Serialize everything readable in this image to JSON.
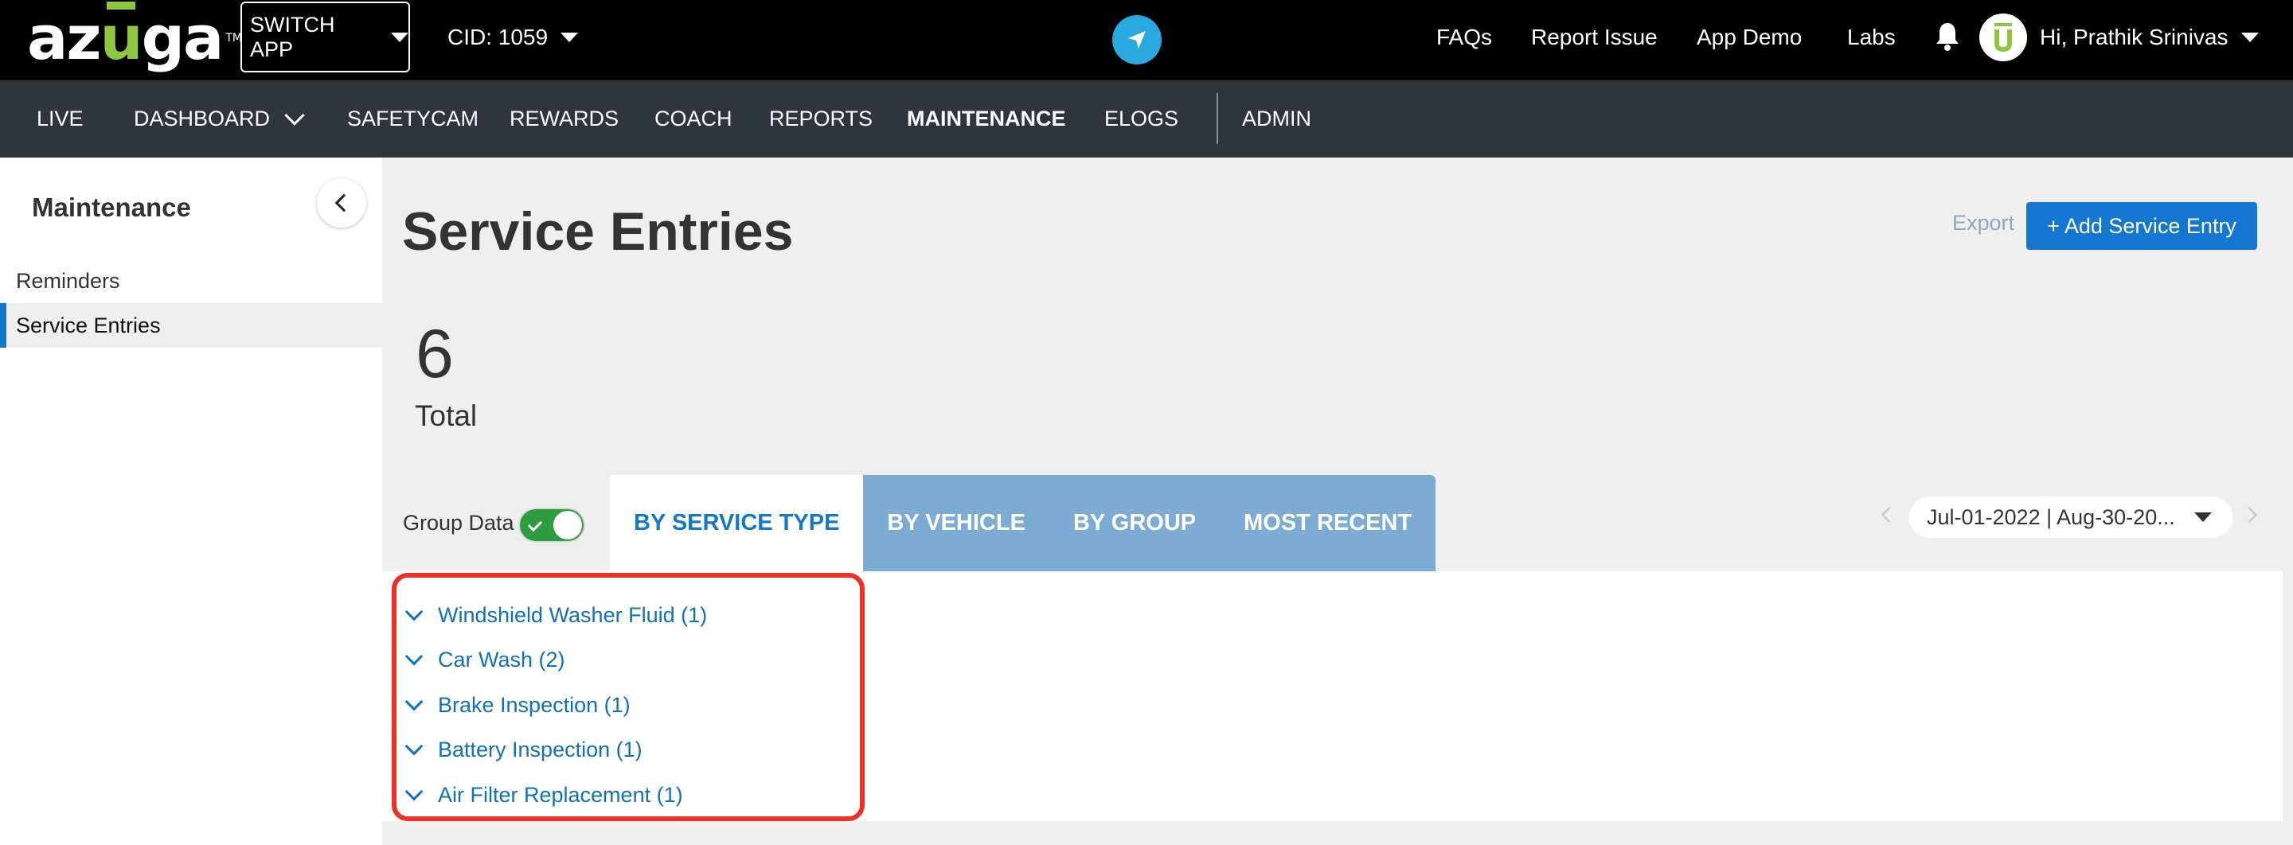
{
  "header": {
    "logo_text": "azuga",
    "logo_tm": "TM",
    "switch_app_label": "SWITCH APP",
    "cid_label": "CID: 1059",
    "links": [
      "FAQs",
      "Report Issue",
      "App Demo",
      "Labs"
    ],
    "greeting": "Hi, Prathik Srinivas",
    "accent_color": "#29a9e0",
    "brand_green": "#8dc63f"
  },
  "nav": {
    "items": [
      "LIVE",
      "DASHBOARD",
      "SAFETYCAM",
      "REWARDS",
      "COACH",
      "REPORTS",
      "MAINTENANCE",
      "ELOGS",
      "ADMIN"
    ],
    "active": "MAINTENANCE"
  },
  "sidebar": {
    "title": "Maintenance",
    "items": [
      "Reminders",
      "Service Entries"
    ],
    "active": "Service Entries"
  },
  "main": {
    "title": "Service Entries",
    "export_label": "Export",
    "add_button_label": "+ Add Service Entry",
    "total_count": "6",
    "total_label": "Total",
    "group_data_label": "Group Data",
    "group_data_on": true,
    "tabs": [
      "BY SERVICE TYPE",
      "BY VEHICLE",
      "BY GROUP",
      "MOST RECENT"
    ],
    "active_tab": "BY SERVICE TYPE",
    "date_range": "Jul-01-2022  |  Aug-30-20...",
    "groups": [
      "Windshield Washer Fluid (1)",
      "Car Wash (2)",
      "Brake Inspection (1)",
      "Battery Inspection (1)",
      "Air Filter Replacement (1)"
    ],
    "primary_color": "#1478d2",
    "highlight_color": "#ee3124"
  }
}
